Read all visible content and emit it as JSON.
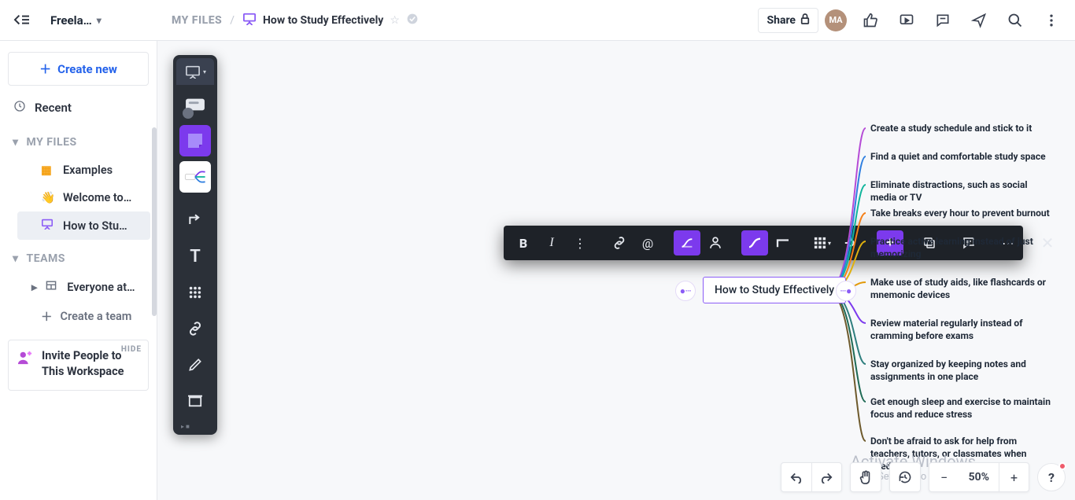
{
  "workspace_name": "Freela…",
  "breadcrumb": {
    "root": "MY FILES",
    "title": "How to Study Effectively"
  },
  "share_label": "Share",
  "avatar_initials": "MA",
  "sidebar": {
    "create_label": "Create new",
    "recent_label": "Recent",
    "section_files": "MY FILES",
    "files": [
      {
        "icon": "🟧",
        "label": "Examples"
      },
      {
        "icon": "👋",
        "label": "Welcome to…"
      },
      {
        "icon": "▢",
        "label": "How to Stu…"
      }
    ],
    "section_teams": "TEAMS",
    "team_label": "Everyone at…",
    "create_team_label": "Create a team",
    "invite": {
      "hide": "HIDE",
      "text": "Invite People to This Workspace"
    }
  },
  "mindmap": {
    "root": "How to Study Effectively",
    "branches": [
      {
        "color": "#b54bd6",
        "text": "Create a study schedule and stick to it"
      },
      {
        "color": "#2f7fe0",
        "text": "Find a quiet and comfortable study space"
      },
      {
        "color": "#0fb59b",
        "text": "Eliminate distractions, such as social media or TV"
      },
      {
        "color": "#f57f17",
        "text": "Take breaks every hour to prevent burnout"
      },
      {
        "color": "#e0b10e",
        "text": "Practice active learning instead of just memorizing"
      },
      {
        "color": "#e29a0a",
        "text": "Make use of study aids, like flashcards or mnemonic devices"
      },
      {
        "color": "#7c3aed",
        "text": "Review material regularly instead of cramming before exams"
      },
      {
        "color": "#2e7e7e",
        "text": "Stay organized by keeping notes and assignments in one place"
      },
      {
        "color": "#1f6a55",
        "text": "Get enough sleep and exercise to maintain focus and reduce stress"
      },
      {
        "color": "#6e5a2c",
        "text": "Don't be afraid to ask for help from teachers, tutors, or classmates when needed"
      }
    ]
  },
  "zoom_label": "50%",
  "watermark": {
    "l1": "Activate Windows",
    "l2": "Go to Settings to activate Windows."
  }
}
